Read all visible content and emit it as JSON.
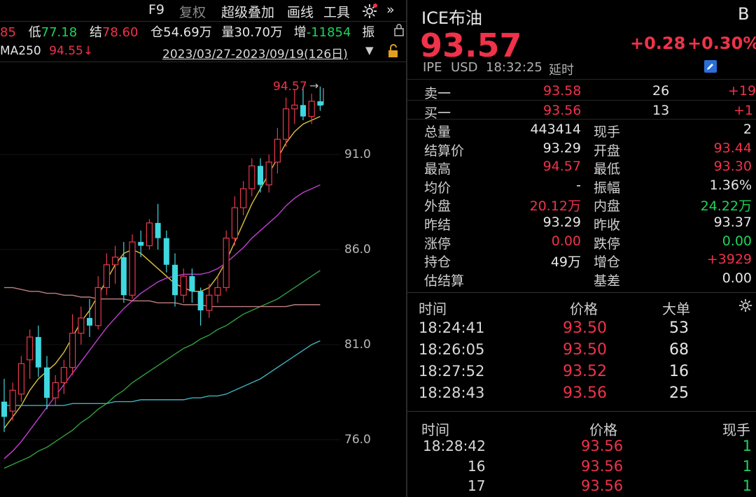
{
  "toolbar": {
    "f9": "F9",
    "fuquan": "复权",
    "overlay": "超级叠加",
    "drawline": "画线",
    "tools": "工具",
    "expand": "»"
  },
  "info_bar": {
    "cut_prev": "85",
    "low_label": "低",
    "low_value": "77.18",
    "settle_label": "结",
    "settle_value": "78.60",
    "oi_label": "仓",
    "oi_value": "54.69万",
    "vol_label": "量",
    "vol_value": "30.70万",
    "inc_label": "增",
    "inc_value": "-11854",
    "amp_label": "振"
  },
  "ma_bar": {
    "ma_label": "MA250",
    "ma_value": "94.55",
    "ma_arrow": "↓",
    "date_range": "2023/03/27-2023/09/19(126日)"
  },
  "price_axis": [
    "91.0",
    "86.0",
    "81.0",
    "76.0"
  ],
  "high_marker": "94.57",
  "header": {
    "name": "ICE布油",
    "badge": "B",
    "price": "93.57",
    "change": "+0.28",
    "change_pct": "+0.30%",
    "exchange": "IPE",
    "currency": "USD",
    "time": "18:32:25",
    "status": "延时"
  },
  "order_book": [
    {
      "label": "卖一",
      "price": "93.58",
      "qty": "26",
      "diff": "+19"
    },
    {
      "label": "买一",
      "price": "93.56",
      "qty": "13",
      "diff": "+1"
    }
  ],
  "stats": [
    {
      "l1": "总量",
      "v1": "443414",
      "c1": "white",
      "l2": "现手",
      "v2": "2",
      "c2": "white"
    },
    {
      "l1": "结算价",
      "v1": "93.29",
      "c1": "white",
      "l2": "开盘",
      "v2": "93.44",
      "c2": "red"
    },
    {
      "l1": "最高",
      "v1": "94.57",
      "c1": "red",
      "l2": "最低",
      "v2": "93.30",
      "c2": "red"
    },
    {
      "l1": "均价",
      "v1": "-",
      "c1": "white",
      "l2": "振幅",
      "v2": "1.36%",
      "c2": "white"
    },
    {
      "l1": "外盘",
      "v1": "20.12万",
      "c1": "red",
      "l2": "内盘",
      "v2": "24.22万",
      "c2": "green"
    },
    {
      "l1": "昨结",
      "v1": "93.29",
      "c1": "white",
      "l2": "昨收",
      "v2": "93.37",
      "c2": "white"
    },
    {
      "l1": "涨停",
      "v1": "0.00",
      "c1": "red",
      "l2": "跌停",
      "v2": "0.00",
      "c2": "green"
    },
    {
      "l1": "持仓",
      "v1": "49万",
      "c1": "white",
      "l2": "增仓",
      "v2": "+3929",
      "c2": "red"
    },
    {
      "l1": "估结算",
      "v1": "",
      "c1": "white",
      "l2": "基差",
      "v2": "0.00",
      "c2": "white"
    }
  ],
  "big_orders": {
    "headers": {
      "time": "时间",
      "price": "价格",
      "size": "大单"
    },
    "rows": [
      {
        "time": "18:24:41",
        "price": "93.50",
        "size": "53"
      },
      {
        "time": "18:26:05",
        "price": "93.50",
        "size": "68"
      },
      {
        "time": "18:27:52",
        "price": "93.52",
        "size": "16"
      },
      {
        "time": "18:28:43",
        "price": "93.56",
        "size": "25"
      }
    ]
  },
  "ticks": {
    "headers": {
      "time": "时间",
      "price": "价格",
      "hand": "现手"
    },
    "rows": [
      {
        "time": "18:28:42",
        "price": "93.56",
        "hand": "1"
      },
      {
        "time": "16",
        "price": "93.56",
        "hand": "1"
      },
      {
        "time": "17",
        "price": "93.56",
        "hand": "1"
      }
    ]
  },
  "colors": {
    "up": "#f0324a",
    "down": "#1ed35a",
    "bg": "#000000",
    "bear_candle": "#3fd8e0",
    "bull_candle": "#e8384c"
  },
  "chart_data": {
    "type": "candlestick",
    "y_range": [
      74.0,
      97.0
    ],
    "y_ticks": [
      91.0,
      86.0,
      81.0,
      76.0
    ],
    "candles": [
      {
        "o": 78.0,
        "h": 79.2,
        "l": 76.4,
        "c": 77.2
      },
      {
        "o": 77.5,
        "h": 79.0,
        "l": 77.0,
        "c": 78.6
      },
      {
        "o": 78.4,
        "h": 80.4,
        "l": 78.0,
        "c": 80.0
      },
      {
        "o": 80.2,
        "h": 81.8,
        "l": 79.2,
        "c": 81.4
      },
      {
        "o": 81.4,
        "h": 82.0,
        "l": 79.3,
        "c": 79.8
      },
      {
        "o": 79.8,
        "h": 80.4,
        "l": 77.6,
        "c": 78.2
      },
      {
        "o": 78.2,
        "h": 79.4,
        "l": 77.8,
        "c": 79.0
      },
      {
        "o": 79.0,
        "h": 80.2,
        "l": 78.4,
        "c": 79.8
      },
      {
        "o": 79.8,
        "h": 82.6,
        "l": 79.4,
        "c": 81.6
      },
      {
        "o": 81.6,
        "h": 83.0,
        "l": 81.0,
        "c": 82.4
      },
      {
        "o": 82.4,
        "h": 83.4,
        "l": 81.4,
        "c": 82.0
      },
      {
        "o": 82.0,
        "h": 84.6,
        "l": 81.8,
        "c": 84.0
      },
      {
        "o": 84.0,
        "h": 85.8,
        "l": 83.6,
        "c": 85.2
      },
      {
        "o": 85.2,
        "h": 86.2,
        "l": 84.2,
        "c": 85.6
      },
      {
        "o": 85.6,
        "h": 86.4,
        "l": 83.2,
        "c": 83.6
      },
      {
        "o": 83.6,
        "h": 86.8,
        "l": 83.4,
        "c": 86.4
      },
      {
        "o": 86.4,
        "h": 87.0,
        "l": 85.6,
        "c": 86.2
      },
      {
        "o": 86.2,
        "h": 87.6,
        "l": 86.0,
        "c": 87.4
      },
      {
        "o": 87.4,
        "h": 88.4,
        "l": 86.0,
        "c": 86.6
      },
      {
        "o": 86.6,
        "h": 87.0,
        "l": 84.8,
        "c": 85.2
      },
      {
        "o": 85.2,
        "h": 85.8,
        "l": 83.0,
        "c": 83.6
      },
      {
        "o": 83.6,
        "h": 85.0,
        "l": 83.2,
        "c": 84.6
      },
      {
        "o": 84.6,
        "h": 85.0,
        "l": 83.2,
        "c": 83.8
      },
      {
        "o": 83.8,
        "h": 84.0,
        "l": 82.0,
        "c": 82.8
      },
      {
        "o": 82.8,
        "h": 84.2,
        "l": 82.4,
        "c": 83.6
      },
      {
        "o": 83.6,
        "h": 84.6,
        "l": 83.2,
        "c": 84.0
      },
      {
        "o": 84.0,
        "h": 87.0,
        "l": 83.8,
        "c": 86.6
      },
      {
        "o": 86.6,
        "h": 88.8,
        "l": 86.2,
        "c": 88.2
      },
      {
        "o": 88.2,
        "h": 89.6,
        "l": 87.8,
        "c": 89.2
      },
      {
        "o": 89.2,
        "h": 90.8,
        "l": 88.8,
        "c": 90.4
      },
      {
        "o": 90.4,
        "h": 90.8,
        "l": 89.0,
        "c": 89.4
      },
      {
        "o": 89.4,
        "h": 91.0,
        "l": 89.0,
        "c": 90.6
      },
      {
        "o": 90.6,
        "h": 92.4,
        "l": 90.0,
        "c": 91.8
      },
      {
        "o": 91.8,
        "h": 94.0,
        "l": 91.4,
        "c": 93.4
      },
      {
        "o": 93.4,
        "h": 94.4,
        "l": 92.6,
        "c": 93.6
      },
      {
        "o": 93.6,
        "h": 94.57,
        "l": 92.8,
        "c": 93.0
      },
      {
        "o": 93.0,
        "h": 94.2,
        "l": 92.6,
        "c": 93.8
      },
      {
        "o": 93.8,
        "h": 94.57,
        "l": 93.3,
        "c": 93.57
      }
    ],
    "ma_lines": [
      {
        "color": "#e0c040",
        "points": [
          76.6,
          77.2,
          77.8,
          78.6,
          79.2,
          79.6,
          80.0,
          80.6,
          81.4,
          82.2,
          82.8,
          83.6,
          84.4,
          85.2,
          85.8,
          86.0,
          85.8,
          85.4,
          85.0,
          84.6,
          84.2,
          84.0,
          83.8,
          83.8,
          84.0,
          84.6,
          85.4,
          86.4,
          87.4,
          88.4,
          89.2,
          90.0,
          90.8,
          91.6,
          92.2,
          92.6,
          92.8,
          93.0
        ]
      },
      {
        "color": "#c040d0",
        "points": [
          75.0,
          75.4,
          75.9,
          76.5,
          77.1,
          77.7,
          78.3,
          78.9,
          79.5,
          80.1,
          80.7,
          81.3,
          81.9,
          82.4,
          82.9,
          83.3,
          83.7,
          84.0,
          84.3,
          84.5,
          84.6,
          84.7,
          84.7,
          84.7,
          84.8,
          85.0,
          85.3,
          85.7,
          86.1,
          86.6,
          87.0,
          87.4,
          87.8,
          88.3,
          88.7,
          89.0,
          89.2,
          89.4
        ]
      },
      {
        "color": "#30a040",
        "points": [
          74.5,
          74.7,
          74.9,
          75.1,
          75.4,
          75.6,
          75.9,
          76.2,
          76.5,
          76.9,
          77.2,
          77.6,
          77.9,
          78.3,
          78.6,
          79.0,
          79.3,
          79.6,
          79.9,
          80.2,
          80.5,
          80.8,
          81.0,
          81.3,
          81.5,
          81.8,
          82.0,
          82.3,
          82.6,
          82.8,
          83.0,
          83.2,
          83.4,
          83.7,
          84.0,
          84.3,
          84.6,
          84.9
        ]
      },
      {
        "color": "#c08080",
        "points": [
          84.0,
          84.0,
          83.9,
          83.8,
          83.8,
          83.7,
          83.7,
          83.6,
          83.6,
          83.5,
          83.5,
          83.4,
          83.4,
          83.4,
          83.4,
          83.3,
          83.3,
          83.3,
          83.2,
          83.2,
          83.2,
          83.1,
          83.1,
          83.1,
          83.0,
          83.0,
          83.0,
          83.0,
          83.0,
          83.0,
          83.0,
          83.0,
          83.0,
          83.0,
          83.1,
          83.1,
          83.1,
          83.1
        ]
      },
      {
        "color": "#40b0c0",
        "points": [
          77.8,
          77.8,
          77.8,
          77.8,
          77.8,
          77.8,
          77.8,
          77.8,
          77.9,
          77.9,
          77.9,
          77.9,
          77.9,
          78.0,
          78.0,
          78.0,
          78.1,
          78.1,
          78.1,
          78.1,
          78.1,
          78.1,
          78.2,
          78.2,
          78.3,
          78.3,
          78.4,
          78.6,
          78.8,
          79.0,
          79.2,
          79.5,
          79.8,
          80.1,
          80.4,
          80.7,
          81.0,
          81.2
        ]
      }
    ]
  }
}
